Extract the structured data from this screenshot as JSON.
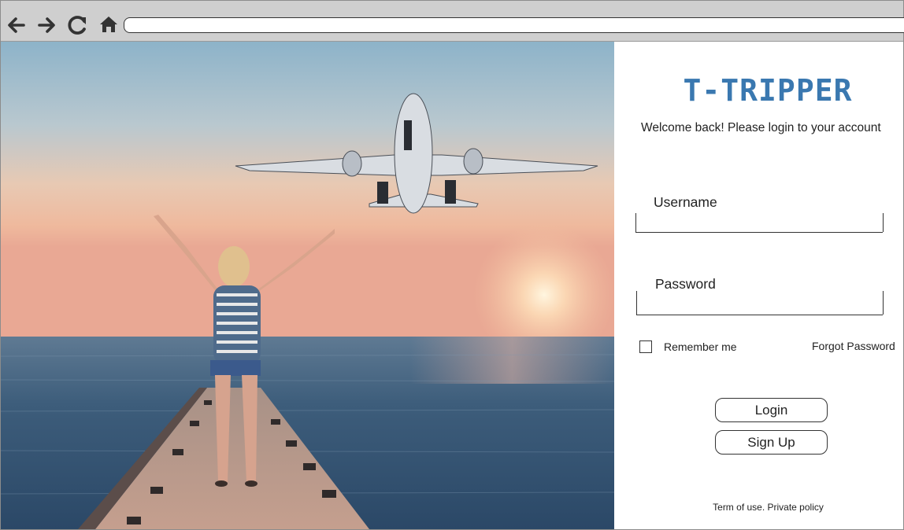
{
  "browser": {
    "back_icon": "arrow-left-icon",
    "forward_icon": "arrow-right-icon",
    "reload_icon": "reload-icon",
    "home_icon": "home-icon",
    "url": ""
  },
  "hero": {
    "image": "woman-on-pier-airplane-sunset-photo"
  },
  "login": {
    "brand": "T-TRIPPER",
    "welcome": "Welcome back! Please login to your account",
    "username_label": "Username",
    "username_value": "",
    "password_label": "Password",
    "password_value": "",
    "remember_label": "Remember me",
    "remember_checked": false,
    "forgot_label": "Forgot Password",
    "login_label": "Login",
    "signup_label": "Sign Up",
    "footer": "Term of use. Private policy"
  },
  "colors": {
    "brand": "#3a78b0",
    "chrome": "#cfcfcf",
    "text": "#222222"
  }
}
